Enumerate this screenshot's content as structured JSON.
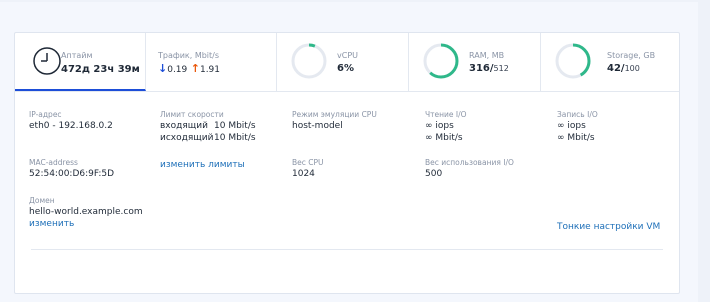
{
  "stats": {
    "uptime": {
      "label": "Аптайм",
      "value": "472д 23ч 39м"
    },
    "traffic": {
      "label": "Трафик, Mbit/s",
      "down": "0.19",
      "up": "1.91"
    },
    "vcpu": {
      "label": "vCPU",
      "value": "6%",
      "percent": 6
    },
    "ram": {
      "label": "RAM, MB",
      "used": "316",
      "total": "512",
      "percent": 61.7
    },
    "storage": {
      "label": "Storage, GB",
      "used": "42",
      "total": "100",
      "percent": 42
    }
  },
  "details": {
    "ip_label": "IP-адрес",
    "ip_value": "eth0 - 192.168.0.2",
    "mac_label": "MAC-address",
    "mac_value": "52:54:00:D6:9F:5D",
    "domain_label": "Домен",
    "domain_value": "hello-world.example.com",
    "domain_change": "изменить",
    "speed_label": "Лимит скорости",
    "speed_in_label": "входящий",
    "speed_in_value": "10 Mbit/s",
    "speed_out_label": "исходящий",
    "speed_out_value": "10 Mbit/s",
    "speed_change": "изменить лимиты",
    "cpu_mode_label": "Режим эмуляции CPU",
    "cpu_mode_value": "host-model",
    "cpu_weight_label": "Вес CPU",
    "cpu_weight_value": "1024",
    "read_label": "Чтение I/O",
    "read_iops": "∞ iops",
    "read_mbit": "∞ Mbit/s",
    "io_weight_label": "Вес использования I/O",
    "io_weight_value": "500",
    "write_label": "Запись I/O",
    "write_iops": "∞ iops",
    "write_mbit": "∞ Mbit/s",
    "fine_tune": "Тонкие настройки VM"
  },
  "colors": {
    "ring": "#2fb88a",
    "ring_track": "#e5e9f0",
    "link": "#1d6fb8",
    "active": "#1d4ed8"
  }
}
